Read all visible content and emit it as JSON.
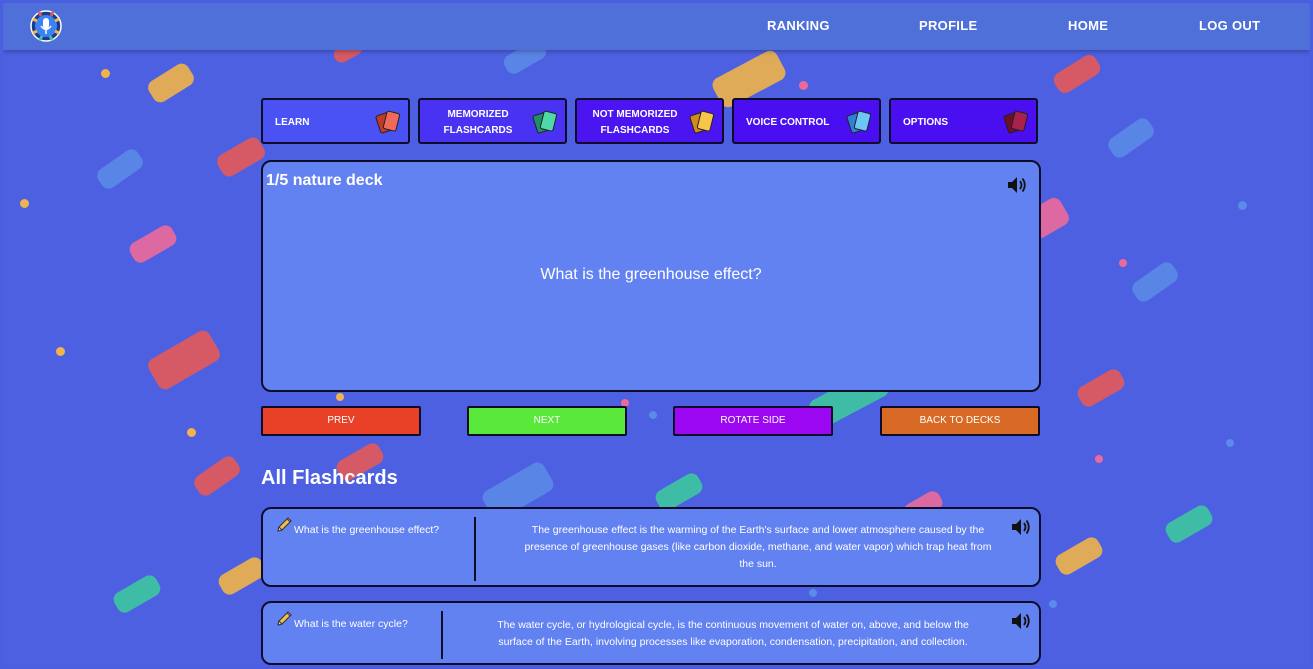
{
  "colors": {
    "background": "#4d60e2",
    "navbar": "#4e70d8",
    "card": "#6382f2",
    "tab_learn": "#4a52f3",
    "tab_dark": "#4a15f0",
    "btn_prev": "#e84128",
    "btn_next": "#5ae83a",
    "btn_rotate": "#9a07f0",
    "btn_back": "#d86a26"
  },
  "nav": {
    "logo_icon": "microphone-logo-icon",
    "links": [
      "RANKING",
      "PROFILE",
      "HOME",
      "LOG OUT"
    ]
  },
  "tabs": [
    {
      "label": "LEARN",
      "icon": "red-cards-icon"
    },
    {
      "label_line1": "MEMORIZED",
      "label_line2": "FLASHCARDS",
      "icon": "green-cards-icon"
    },
    {
      "label_line1": "NOT MEMORIZED",
      "label_line2": "FLASHCARDS",
      "icon": "yellow-cards-icon"
    },
    {
      "label": "VOICE CONTROL",
      "icon": "blue-cards-icon"
    },
    {
      "label": "OPTIONS",
      "icon": "maroon-cards-icon"
    }
  ],
  "study_card": {
    "deck_title": "1/5 nature deck",
    "question": "What is the greenhouse effect?",
    "speaker_icon": "speaker-icon"
  },
  "controls": {
    "prev": "PREV",
    "next": "NEXT",
    "rotate": "ROTATE SIDE",
    "back": "BACK TO DECKS"
  },
  "all_flashcards": {
    "title": "All Flashcards",
    "items": [
      {
        "front": "What is the greenhouse effect?",
        "back_line1": "The greenhouse effect is the warming of the Earth's surface and lower atmosphere caused by the",
        "back_line2": "presence of greenhouse gases (like carbon dioxide, methane, and water vapor) which trap heat from",
        "back_line3": "the sun."
      },
      {
        "front": "What is the water cycle?",
        "back_line1": "The water cycle, or hydrological cycle, is the continuous movement of water on, above, and below the",
        "back_line2": "surface of the Earth, involving processes like evaporation, condensation, precipitation, and collection."
      }
    ]
  }
}
